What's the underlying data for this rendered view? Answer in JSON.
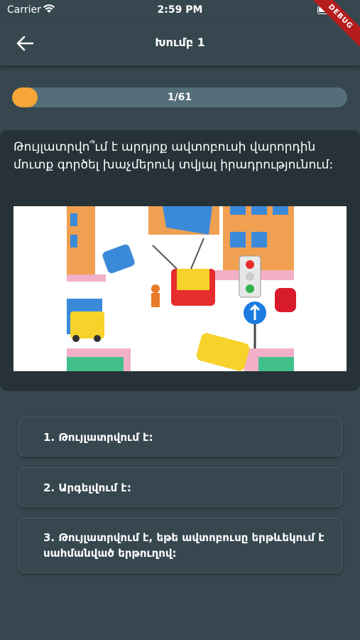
{
  "status_bar": {
    "carrier": "Carrier",
    "time": "2:59 PM",
    "wifi_icon": "wifi-icon",
    "battery_icon": "battery-icon"
  },
  "debug_banner": "DEBUG",
  "app_bar": {
    "title": "Խումբ 1",
    "back_icon": "arrow-left-icon"
  },
  "progress": {
    "text": "1/61",
    "current": 1,
    "total": 61
  },
  "question": {
    "text": "Թույլատրվո՞ւմ է արդյոք ավտոբուսի վարորդին մուտք գործել խաչմերուկ տվյալ իրադրությունում:",
    "image_description_icon": "traffic-scene-illustration"
  },
  "answers": [
    {
      "label": "1. Թույլատրվում է:"
    },
    {
      "label": "2. Արգելվում է:"
    },
    {
      "label": "3. Թույլատրվում է, եթե ավտոբուսը երթևեկում է սահմանված երթուղով:"
    }
  ],
  "colors": {
    "background": "#37474f",
    "card": "#263238",
    "accent": "#f5a637",
    "track": "#546e7a",
    "debug": "#b71c1c"
  }
}
